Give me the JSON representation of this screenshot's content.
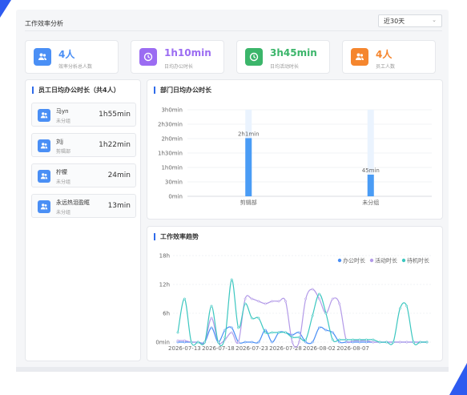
{
  "header": {
    "title": "工作效率分析",
    "range_value": "近30天"
  },
  "stats": [
    {
      "value": "4人",
      "label": "效率分析总人数",
      "color": "#4a8ff5",
      "icon": "users-icon"
    },
    {
      "value": "1h10min",
      "label": "日均办公时长",
      "color": "#9b6cf2",
      "icon": "clock-icon"
    },
    {
      "value": "3h45min",
      "label": "日均活动时长",
      "color": "#3bb56a",
      "icon": "clock-icon"
    },
    {
      "value": "4人",
      "label": "员工人数",
      "color": "#f5862e",
      "icon": "users-icon"
    }
  ],
  "employees_panel": {
    "title": "员工日均办公时长（共4人）",
    "items": [
      {
        "name": "马yn",
        "dept": "未分组",
        "time": "1h55min"
      },
      {
        "name": "刘j",
        "dept": "剪辑部",
        "time": "1h22min"
      },
      {
        "name": "柠檬",
        "dept": "未分组",
        "time": "24min"
      },
      {
        "name": "永远热泪盈眶",
        "dept": "未分组",
        "time": "13min"
      }
    ]
  },
  "chart_data": [
    {
      "type": "bar",
      "title": "部门日均办公时长",
      "categories": [
        "剪辑部",
        "未分组"
      ],
      "values": [
        121,
        45
      ],
      "data_labels": [
        "2h1min",
        "45min"
      ],
      "y_ticks": [
        "0min",
        "30min",
        "1h0min",
        "1h30min",
        "2h0min",
        "2h30min",
        "3h0min"
      ],
      "ylim": [
        0,
        180
      ],
      "grid": true
    },
    {
      "type": "line",
      "title": "工作效率趋势",
      "x_ticks": [
        "2026-07-13",
        "2026-07-18",
        "2026-07-23",
        "2026-07-28",
        "2026-08-02",
        "2026-08-07"
      ],
      "y_ticks": [
        "0min",
        "6h",
        "12h",
        "18h"
      ],
      "ylim": [
        0,
        18
      ],
      "legend_position": "top-right",
      "series": [
        {
          "name": "办公时长",
          "color": "#4a8ff5",
          "values": [
            0,
            0,
            0,
            0,
            0,
            3,
            0,
            2.5,
            3,
            0,
            0,
            0,
            0,
            2.5,
            0,
            2,
            2,
            1.5,
            2,
            0,
            0,
            3,
            2.5,
            2,
            0,
            0,
            0,
            0,
            0,
            0,
            0,
            0,
            0,
            0,
            0,
            0,
            0,
            0
          ]
        },
        {
          "name": "活动时长",
          "color": "#b39ae8",
          "values": [
            0.3,
            0.3,
            0,
            0,
            0,
            5,
            0,
            0.5,
            2,
            0,
            9,
            9,
            8.5,
            8,
            8.5,
            8.5,
            8.5,
            0,
            0,
            9,
            11,
            9,
            6,
            9,
            8,
            0.5,
            0.3,
            0.3,
            0.3,
            0,
            0,
            0,
            0,
            0,
            0,
            0,
            0,
            0
          ]
        },
        {
          "name": "待机时长",
          "color": "#3cc7c0",
          "values": [
            2,
            9,
            0,
            0,
            0,
            7.5,
            0,
            1,
            13,
            3,
            8,
            5,
            5,
            2,
            2,
            2,
            2,
            1,
            1,
            0.5,
            5.5,
            10,
            6,
            0.5,
            0.5,
            0.5,
            0.5,
            0.5,
            0.5,
            0.5,
            0,
            0,
            0,
            7,
            7.5,
            0,
            0,
            0
          ]
        }
      ]
    }
  ]
}
